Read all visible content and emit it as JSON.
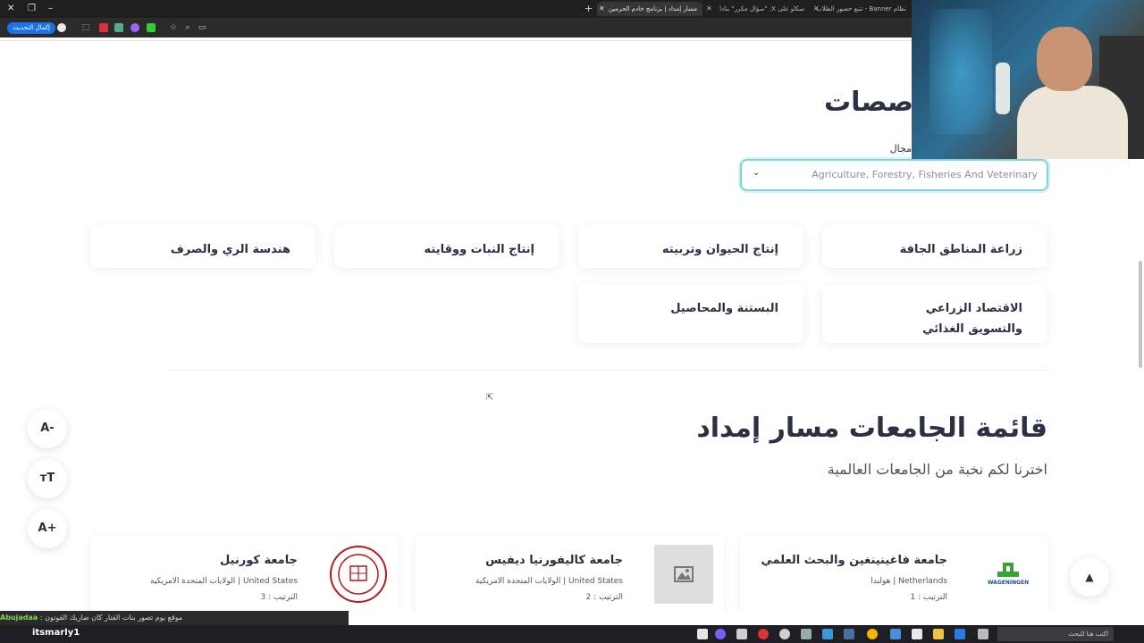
{
  "browser": {
    "tabs": [
      {
        "title": "نظام Banner - تتبع حضور الطلاب",
        "active": false
      },
      {
        "title": "سكاو على X: \"سؤال مكرر\" بنادا",
        "active": false
      },
      {
        "title": "مسار إمداد | برنامج خادم الحرمين",
        "active": true
      }
    ],
    "new_tab": "+",
    "update_button": "إكمال التحديث"
  },
  "specializations": {
    "title": "صصات",
    "field_label": "مجال",
    "selected_field": "Agriculture, Forestry, Fisheries And Veterinary",
    "items": [
      "زراعة المناطق الجافة",
      "إنتاج الحيوان وتربيته",
      "إنتاج النبات ووقايته",
      "هندسة الري والصرف",
      "الاقتصاد الزراعي والتسويق الغذائي",
      "البستنة والمحاصيل"
    ]
  },
  "universities": {
    "title": "قائمة الجامعات مسار إمداد",
    "subtitle": "اخترنا لكم نخبة من الجامعات العالمية",
    "items": [
      {
        "name": "جامعة فاغينينغين والبحث العلمي",
        "country": "Netherlands | هولندا",
        "rank": "الترتيب : 1",
        "logo_text": "WAGENINGEN"
      },
      {
        "name": "جامعة كاليفورنيا ديفيس",
        "country": "United States | الولايات المتحدة الامريكية",
        "rank": "الترتيب : 2"
      },
      {
        "name": "جامعة كورنيل",
        "country": "United States | الولايات المتحدة الامريكية",
        "rank": "الترتيب : 3"
      }
    ]
  },
  "font_controls": {
    "decrease": "A-",
    "reset": "тT",
    "increase": "A+"
  },
  "scroll_top_icon": "chevron-up-icon",
  "chat": {
    "user": "Abujadaa",
    "message": ": موقع يوم تصور بنات القتار كان ضاربك القوتون"
  },
  "taskbar": {
    "username": "itsmarly1",
    "search_placeholder": "اكتب هنا للبحث"
  },
  "colors": {
    "accent": "#7fd3dc",
    "text": "#2b3043",
    "update_blue": "#1a73e8"
  }
}
